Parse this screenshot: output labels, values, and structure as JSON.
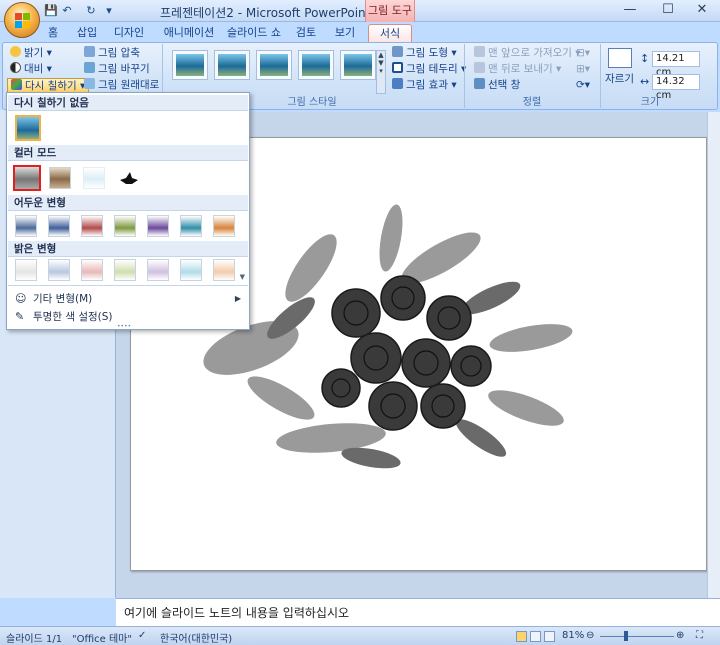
{
  "window": {
    "title": "프레젠테이션2 - Microsoft PowerPoint",
    "context_tab": "그림 도구",
    "min": "—",
    "max": "☐",
    "close": "✕"
  },
  "tabs": [
    "홈",
    "삽입",
    "디자인",
    "애니메이션",
    "슬라이드 쇼",
    "검토",
    "보기",
    "서식"
  ],
  "ribbon": {
    "adjust": {
      "brightness": "밝기 ▾",
      "contrast": "대비 ▾",
      "recolor": "다시 칠하기 ▾",
      "compress": "그림 압축",
      "change_picture": "그림 바꾸기",
      "reset_picture": "그림 원래대로"
    },
    "styles": {
      "group_label": "그림 스타일",
      "shape": "그림 도형 ▾",
      "border": "그림 테두리 ▾",
      "effects": "그림 효과 ▾"
    },
    "arrange": {
      "group_label": "정렬",
      "bring_forward": "맨 앞으로 가져오기 ▾",
      "send_backward": "맨 뒤로 보내기 ▾",
      "selection_pane": "선택 창"
    },
    "size": {
      "group_label": "크기",
      "crop": "자르기",
      "height": "14.21 cm",
      "width": "14.32 cm"
    }
  },
  "recolor_menu": {
    "no_recolor": "다시 칠하기 없음",
    "color_modes": "컬러 모드",
    "dark_variations": "어두운 변형",
    "light_variations": "밝은 변형",
    "more_variations": "기타 변형(M)",
    "set_transparent": "투명한 색 설정(S)",
    "dark_colors": [
      "#4c6a9a",
      "#3f5f9a",
      "#b24a4a",
      "#7f9a3f",
      "#6a4a9a",
      "#2f8fa8",
      "#d8843a"
    ],
    "light_colors": [
      "#e4e4e4",
      "#b8c8e0",
      "#e8b8b8",
      "#d0ddb0",
      "#d0c0e0",
      "#b0dbe8",
      "#f2ccaa"
    ]
  },
  "notes": "여기에 슬라이드 노트의 내용을 입력하십시오",
  "status": {
    "slide": "슬라이드 1/1",
    "theme": "\"Office 테마\"",
    "language": "한국어(대한민국)",
    "zoom": "81%"
  }
}
